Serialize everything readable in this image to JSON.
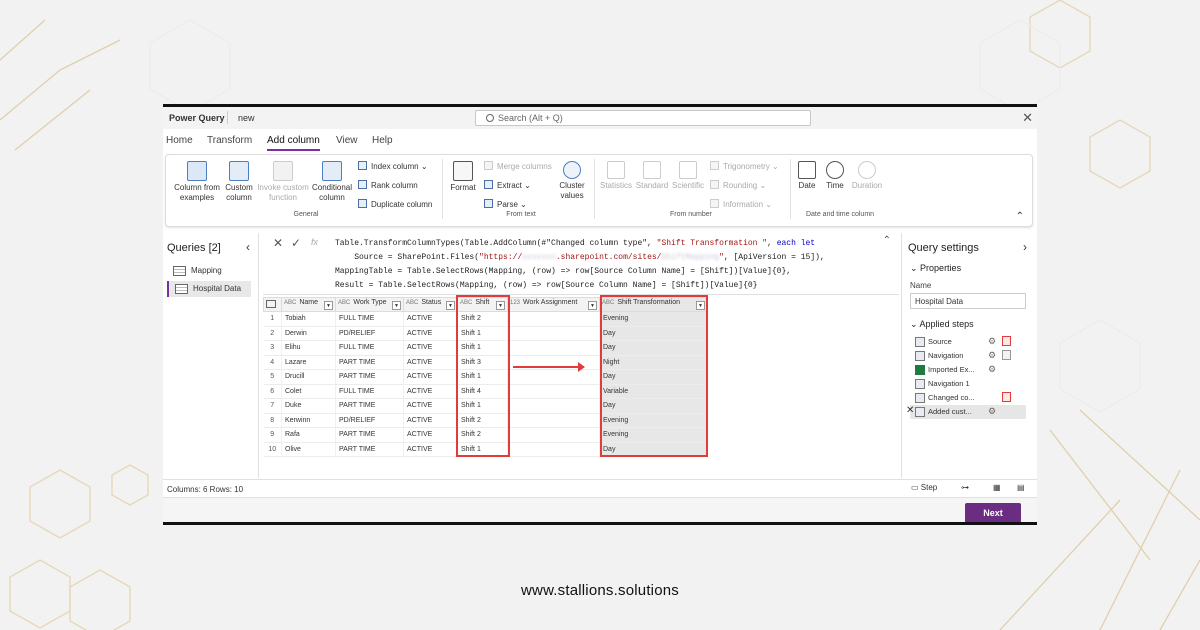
{
  "footer": {
    "url": "www.stallions.solutions"
  },
  "app": {
    "title": "Power Query",
    "document": "new",
    "search_placeholder": "Search (Alt + Q)"
  },
  "menu": [
    "Home",
    "Transform",
    "Add column",
    "View",
    "Help"
  ],
  "menu_active": "Add column",
  "ribbon": {
    "general": {
      "group_label": "General",
      "column_from_examples": "Column from examples",
      "custom_column": "Custom column",
      "invoke_custom_function": "Invoke custom function",
      "conditional_column": "Conditional column",
      "index_column": "Index column",
      "rank_column": "Rank column",
      "duplicate_column": "Duplicate column"
    },
    "from_text": {
      "group_label": "From text",
      "format": "Format",
      "merge_columns": "Merge columns",
      "extract": "Extract",
      "parse": "Parse",
      "cluster_values": "Cluster values"
    },
    "from_number": {
      "group_label": "From number",
      "statistics": "Statistics",
      "standard": "Standard",
      "scientific": "Scientific",
      "trigonometry": "Trigonometry",
      "rounding": "Rounding",
      "information": "Information"
    },
    "date_time": {
      "group_label": "Date and time column",
      "date": "Date",
      "time": "Time",
      "duration": "Duration"
    }
  },
  "queries": {
    "header": "Queries [2]",
    "items": [
      "Mapping",
      "Hospital Data"
    ],
    "selected": "Hospital Data"
  },
  "formula": {
    "line1_pre": "Table.TransformColumnTypes(Table.AddColumn(#\"Changed column type\", ",
    "line1_str": "\"Shift Transformation \"",
    "line1_mid": ", ",
    "line1_kw": "each let",
    "line2_pre": "    Source = SharePoint.Files(",
    "line2_str_a": "\"https://",
    "line2_blur1": "xxxxxxx",
    "line2_str_b": ".sharepoint.com/sites/",
    "line2_blur2": "ShiftMapping",
    "line2_str_c": "\"",
    "line2_post": ", [ApiVersion = 15]),",
    "line3": "MappingTable = Table.SelectRows(Mapping, (row) => row[Source Column Name] = [Shift])[Value]{0},",
    "line4": "Result = Table.SelectRows(Mapping, (row) => row[Source Column Name] = [Shift])[Value]{0}"
  },
  "table": {
    "columns": [
      "Name",
      "Work Type",
      "Status",
      "Shift",
      "Work Assignment",
      "Shift Transformation"
    ],
    "rows": [
      [
        "1",
        "Tobiah",
        "FULL TIME",
        "ACTIVE",
        "Shift 2",
        "",
        "Evening"
      ],
      [
        "2",
        "Derwin",
        "PD/RELIEF",
        "ACTIVE",
        "Shift 1",
        "",
        "Day"
      ],
      [
        "3",
        "Elihu",
        "FULL TIME",
        "ACTIVE",
        "Shift 1",
        "",
        "Day"
      ],
      [
        "4",
        "Lazare",
        "PART TIME",
        "ACTIVE",
        "Shift 3",
        "",
        "Night"
      ],
      [
        "5",
        "Drucill",
        "PART TIME",
        "ACTIVE",
        "Shift 1",
        "",
        "Day"
      ],
      [
        "6",
        "Colet",
        "FULL TIME",
        "ACTIVE",
        "Shift 4",
        "",
        "Variable"
      ],
      [
        "7",
        "Duke",
        "PART TIME",
        "ACTIVE",
        "Shift 1",
        "",
        "Day"
      ],
      [
        "8",
        "Kerwinn",
        "PD/RELIEF",
        "ACTIVE",
        "Shift 2",
        "",
        "Evening"
      ],
      [
        "9",
        "Rafa",
        "PART TIME",
        "ACTIVE",
        "Shift 2",
        "",
        "Evening"
      ],
      [
        "10",
        "Olive",
        "PART TIME",
        "ACTIVE",
        "Shift 1",
        "",
        "Day"
      ]
    ]
  },
  "settings": {
    "header": "Query settings",
    "properties": "Properties",
    "name_label": "Name",
    "name_value": "Hospital Data",
    "applied_steps": "Applied steps",
    "steps": [
      "Source",
      "Navigation",
      "Imported Ex...",
      "Navigation 1",
      "Changed co...",
      "Added cust..."
    ]
  },
  "status": {
    "text": "Columns: 6   Rows: 10",
    "step": "Step"
  },
  "buttons": {
    "next": "Next"
  },
  "colors": {
    "accent": "#6b2d82",
    "highlight": "#e23b3b"
  }
}
